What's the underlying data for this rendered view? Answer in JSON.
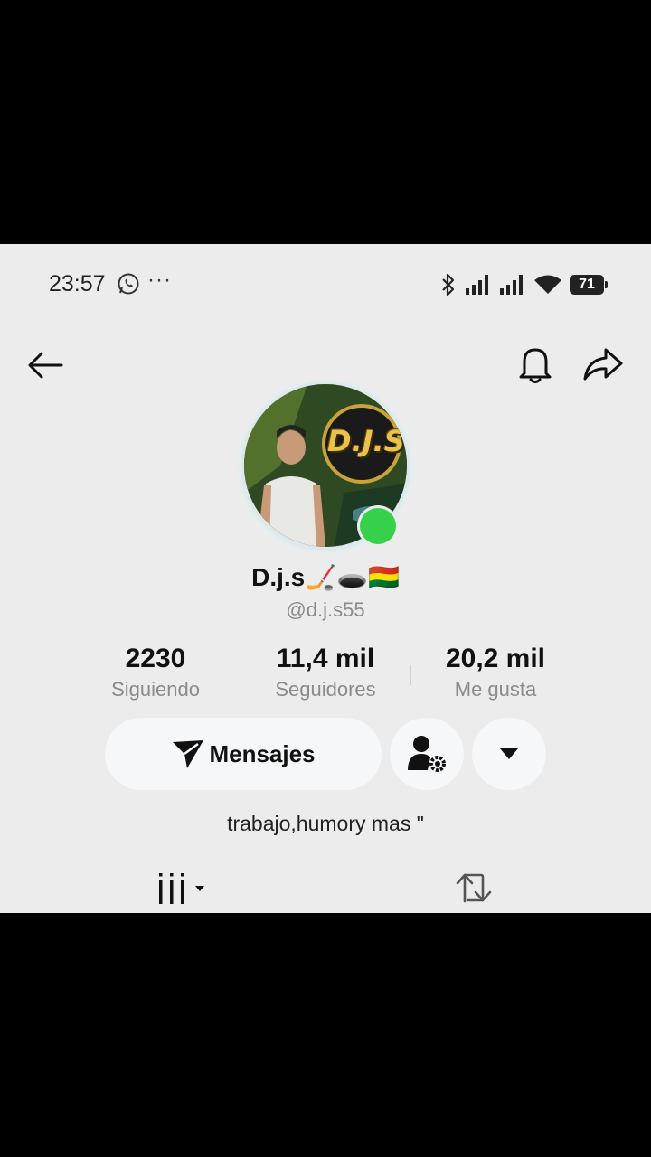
{
  "status_bar": {
    "time": "23:57",
    "more": "···",
    "battery": "71",
    "icons": [
      "whatsapp-icon",
      "bluetooth-icon",
      "signal-icon",
      "signal-icon",
      "wifi-icon",
      "battery-icon"
    ]
  },
  "header": {
    "icons": [
      "back-arrow-icon",
      "bell-icon",
      "share-icon"
    ]
  },
  "profile": {
    "display_name": "D.j.s🏒🕳️🇧🇴",
    "avatar_logo_text": "D.J.S",
    "username": "@d.j.s55",
    "online_color": "#35d14a",
    "bio": "trabajo,humory mas  \""
  },
  "stats": [
    {
      "value": "2230",
      "label": "Siguiendo"
    },
    {
      "value": "11,4 mil",
      "label": "Seguidores"
    },
    {
      "value": "20,2 mil",
      "label": "Me gusta"
    }
  ],
  "actions": {
    "messages_label": "Mensajes",
    "icons": [
      "send-icon",
      "user-settings-icon",
      "dropdown-triangle-icon"
    ]
  },
  "tabs": {
    "icons": [
      "videos-grid-icon",
      "repost-icon"
    ]
  }
}
